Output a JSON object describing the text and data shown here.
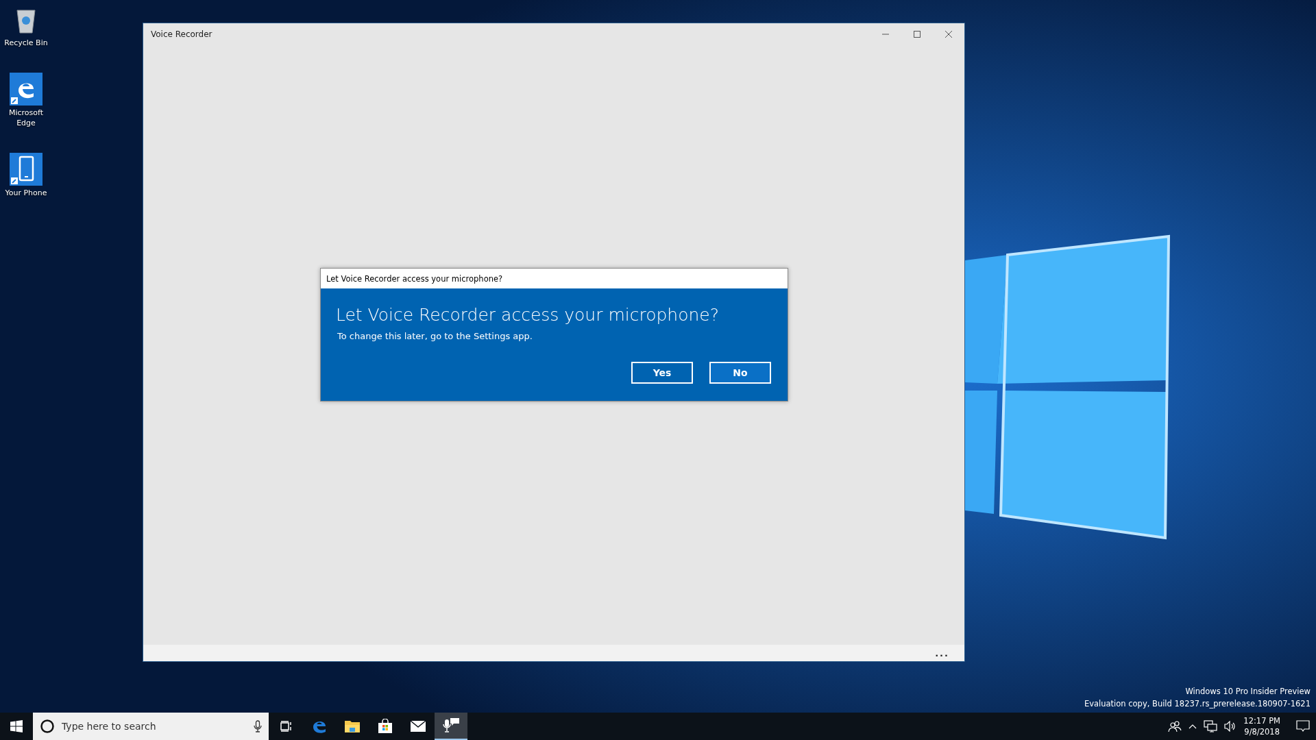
{
  "desktop_icons": [
    {
      "label": "Recycle Bin",
      "kind": "recycle"
    },
    {
      "label": "Microsoft Edge",
      "kind": "edge"
    },
    {
      "label": "Your Phone",
      "kind": "phone"
    }
  ],
  "window": {
    "title": "Voice Recorder",
    "more": "..."
  },
  "dialog": {
    "title": "Let Voice Recorder access your microphone?",
    "heading": "Let Voice Recorder access your microphone?",
    "message": "To change this later, go to the Settings app.",
    "buttons": [
      {
        "label": "Yes",
        "selected": false
      },
      {
        "label": "No",
        "selected": true
      }
    ]
  },
  "build_info": [
    "Windows 10 Pro Insider Preview",
    "Evaluation copy, Build 18237.rs_prerelease.180907-1621"
  ],
  "taskbar": {
    "search_placeholder": "Type here to search",
    "apps": [
      {
        "kind": "task-view",
        "active": false
      },
      {
        "kind": "edge",
        "active": false
      },
      {
        "kind": "explorer",
        "active": false
      },
      {
        "kind": "store",
        "active": false
      },
      {
        "kind": "mail",
        "active": false
      },
      {
        "kind": "voice-recorder",
        "active": true
      }
    ],
    "time": "12:17 PM",
    "date": "9/8/2018"
  }
}
